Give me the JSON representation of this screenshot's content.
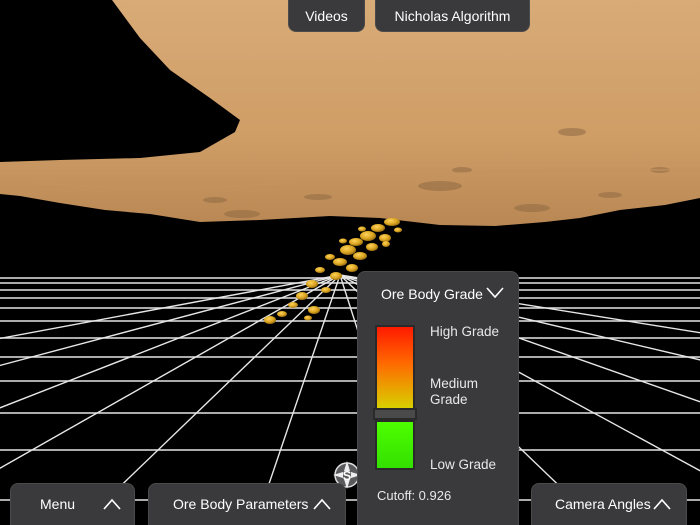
{
  "top_buttons": {
    "videos": "Videos",
    "algorithm": "Nicholas Algorithm"
  },
  "bottom_bar": {
    "menu": "Menu",
    "ore_body_parameters": "Ore Body Parameters",
    "camera_angles": "Camera Angles"
  },
  "legend": {
    "title": "Ore Body Grade",
    "high": "High Grade",
    "medium": "Medium Grade",
    "low": "Low Grade",
    "cutoff": "Cutoff: 0.926"
  },
  "compass": {
    "letter": "S"
  },
  "colors": {
    "terrain": "#d1a06a",
    "ore": "#d9a21f",
    "grid": "#ffffff",
    "high_grade": "#ff1a00",
    "low_grade": "#3cff00",
    "panel": "#3a3a3c"
  },
  "icons": [
    "chevron-up-icon",
    "chevron-down-icon",
    "compass-icon"
  ]
}
